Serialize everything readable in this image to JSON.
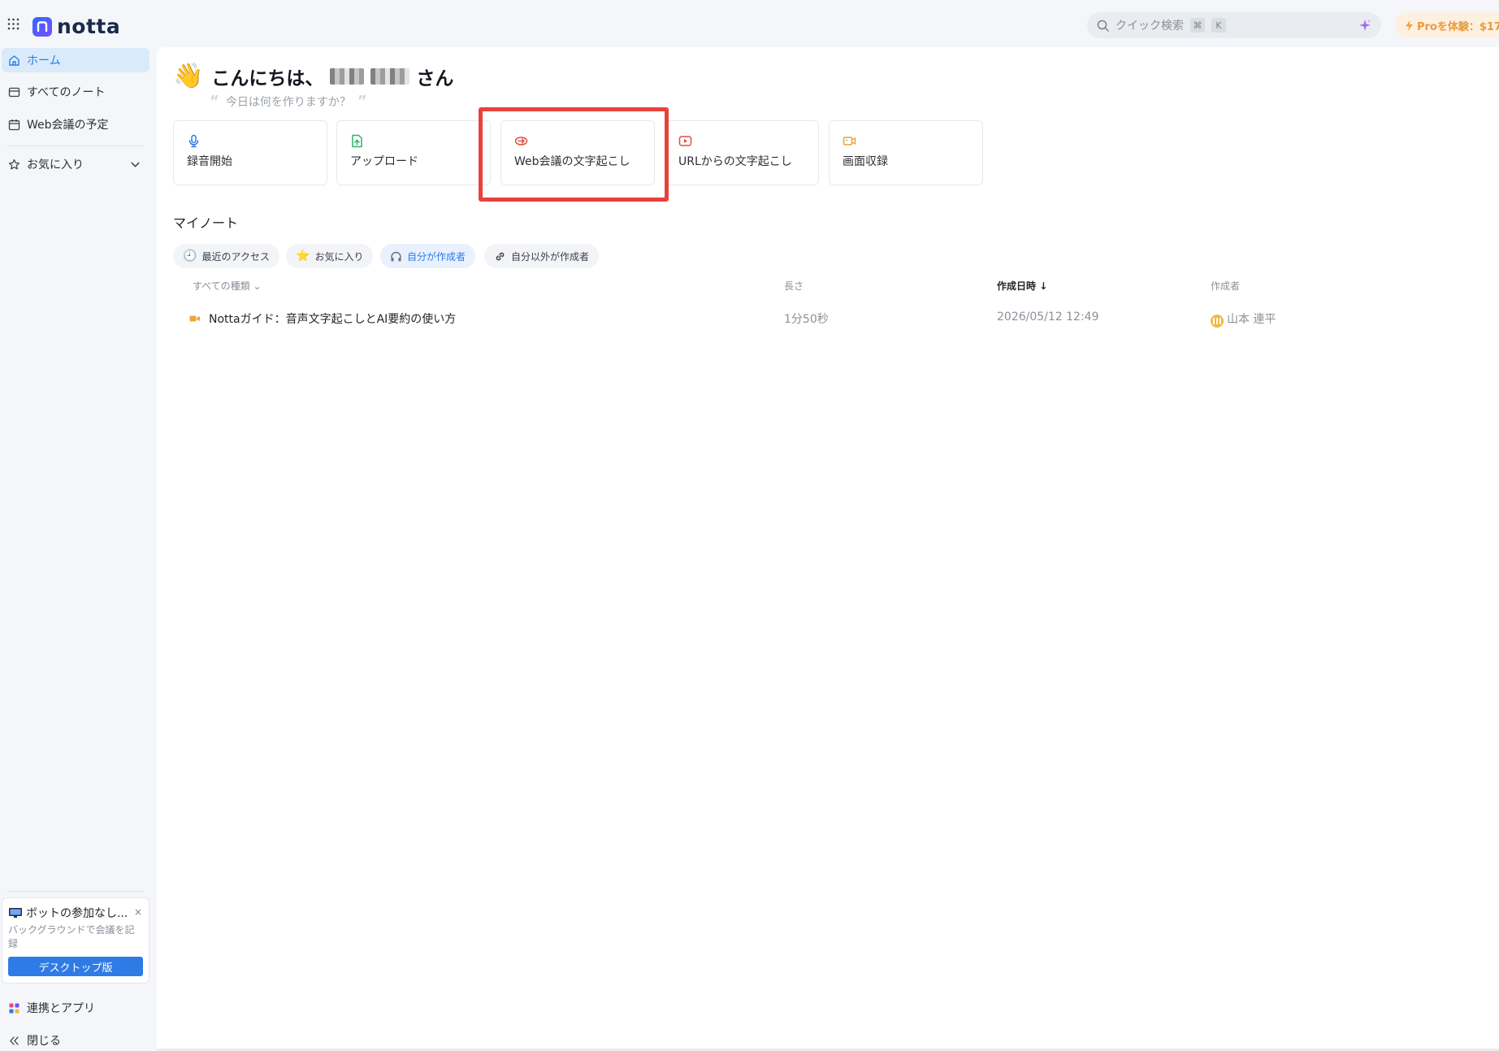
{
  "app": {
    "brand": "notta",
    "search_placeholder": "クイック検索",
    "search_kbd_1": "⌘",
    "search_kbd_2": "K",
    "pro_label": "Proを体験：$17"
  },
  "sidebar": {
    "items": [
      {
        "label": "ホーム",
        "active": true
      },
      {
        "label": "すべてのノート"
      },
      {
        "label": "Web会議の予定"
      },
      {
        "label": "お気に入り"
      }
    ],
    "promo": {
      "title": "ボットの参加なし...",
      "close": "×",
      "desc": "バックグラウンドで会議を記録",
      "button": "デスクトップ版"
    },
    "bottom": {
      "apps": "連携とアプリ",
      "collapse": "閉じる"
    }
  },
  "main": {
    "greeting_prefix": "こんにちは、",
    "greeting_suffix": "さん",
    "subtitle": "今日は何を作りますか？",
    "cards": [
      {
        "label": "録音開始",
        "icon": "mic-icon",
        "color": "#2d7be5"
      },
      {
        "label": "アップロード",
        "icon": "upload-icon",
        "color": "#2fb36b"
      },
      {
        "label": "Web会議の文字起こし",
        "icon": "meeting-icon",
        "color": "#e0503d"
      },
      {
        "label": "URLからの文字起こし",
        "icon": "youtube-icon",
        "color": "#e24c42"
      },
      {
        "label": "画面収録",
        "icon": "screen-record-icon",
        "color": "#e8a33a"
      }
    ],
    "section_title": "マイノート",
    "chips": [
      {
        "label": "最近のアクセス"
      },
      {
        "label": "お気に入り"
      },
      {
        "label": "自分が作成者",
        "active": true
      },
      {
        "label": "自分以外が作成者"
      }
    ],
    "table": {
      "headers": {
        "type": "すべての種類",
        "length": "長さ",
        "created": "作成日時",
        "author": "作成者"
      },
      "rows": [
        {
          "title": "Nottaガイド：音声文字起こしとAI要約の使い方",
          "length": "1分50秒",
          "created": "2026/05/12 12:49",
          "author": "山本 連平"
        }
      ]
    }
  },
  "colors": {
    "accent": "#2d7be5",
    "highlight": "#e8423d"
  }
}
